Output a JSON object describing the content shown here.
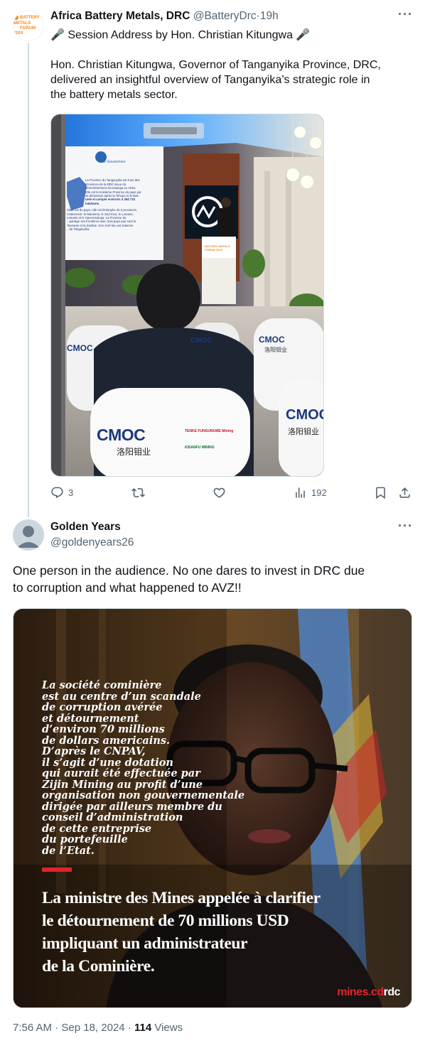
{
  "tweet1": {
    "avatar_text": [
      "BATTERY METALS",
      "FORUM 2024"
    ],
    "author_name": "Africa Battery Metals, DRC",
    "author_handle": "@BatteryDrc",
    "separator": "·",
    "time": "19h",
    "more": "···",
    "text_lines": [
      "🎤 Session Address by Hon. Christian Kitungwa 🎤",
      "",
      "Hon. Christian Kitungwa, Governor of Tanganyika Province, DRC,",
      "delivered an insightful overview of Tanganyika’s strategic role in",
      "the battery metals sector."
    ],
    "media": {
      "slide_subtitle": "Le Gouverneur",
      "slide_lines": [
        "La Province du Tanganyika est l'une des",
        "Provinces de la RDC issue du",
        "démembrement du Katanga en 2015.",
        "Elle est la troisième Province du pays par",
        "sa dimension après la Tshopo et le Bas-",
        "Uele et compte environs 4 284 733",
        "habitants.",
        "",
        "Situé est du pays, elle est limitrophe de 5 provinces,",
        "notamment: le Maniema, le Sud Kivu, le Lomami,",
        "Lomami et le Haut-Katanga. La Province du",
        "...partage ses frontières avec trois pays que sont le",
        "Tanzanie et la Zambie. Son chef-lieu est Kalemie",
        "...de Tanganyika"
      ],
      "podium_label": [
        "BATTERY METALS",
        "FORUM 2024"
      ],
      "chair_brand_1": "CMOC",
      "chair_brand_1_cn": "洛阳钼业",
      "chair_brand_2": "TENKE FUNGURUME Mining",
      "chair_brand_3": "KISANFU MINING",
      "chair_brand_back": "CMOC",
      "chair_brand_back_cn": "洛阳钼业"
    },
    "actions": {
      "replies": "3",
      "retweets": "",
      "likes": "",
      "views": "192"
    }
  },
  "tweet2": {
    "author_name": "Golden Years",
    "author_handle": "@goldenyears26",
    "more": "···",
    "text_lines": [
      "One person in the audience. No one dares to invest in DRC due",
      "to corruption and what happened to AVZ!!"
    ],
    "media": {
      "quote_lines": [
        "La société cominière",
        "est au centre d’un scandale",
        "de corruption avérée",
        "et détournement",
        "d’environ 70 millions",
        "de dollars americains.",
        "D’après le CNPAV,",
        "il s’agit d’une dotation",
        "qui aurait été effectuée par",
        "Zijin Mining au profit d’une",
        "organisation non gouvernementale",
        "dirigée par ailleurs membre du",
        "conseil d’administration",
        "de cette entreprise",
        "du portefeuille",
        "de l’Etat."
      ],
      "headline_lines": [
        "La ministre des Mines appelée à clarifier",
        "le détournement de 70 millions USD",
        "impliquant un administrateur",
        "de la Cominière."
      ],
      "brand_red": "mines.cd",
      "brand_white": "rdc"
    },
    "footer": {
      "time": "7:56 AM",
      "sep1": "·",
      "date": "Sep 18, 2024",
      "sep2": "·",
      "views_count": "114",
      "views_label": "Views"
    }
  },
  "colors": {
    "text_primary": "#0f1419",
    "text_secondary": "#536471",
    "thread_line": "#cfd9de",
    "brand_red": "#e0242b",
    "brand_orange": "#f08a24"
  }
}
